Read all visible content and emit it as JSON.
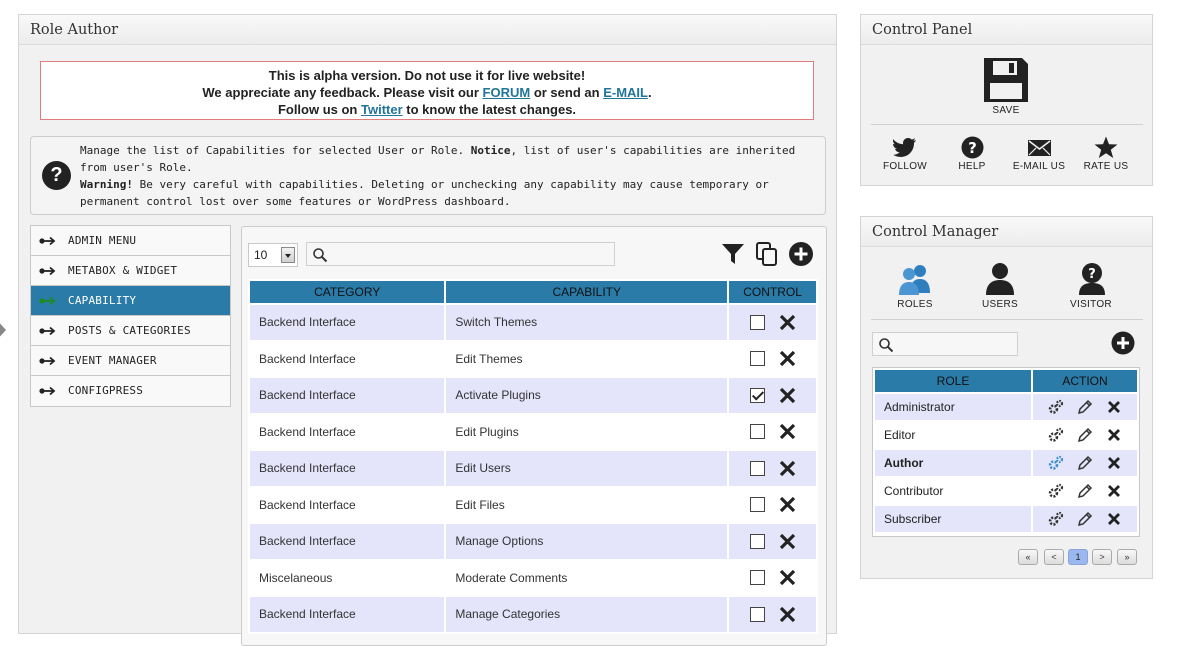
{
  "main": {
    "title": "Role Author",
    "notice": {
      "line1": "This is alpha version. Do not use it for live website!",
      "line2_pre": "We appreciate any feedback. Please visit our",
      "forum_link": "FORUM",
      "line2_mid": "or send an",
      "email_link": "E-MAIL",
      "line2_end": ".",
      "line3_pre": "Follow us on",
      "twitter_link": "Twitter",
      "line3_post": "to know the latest changes."
    },
    "help": {
      "icon_text": "?",
      "t1": "Manage the list of Capabilities for selected User or Role.",
      "t1_bold": "Notice",
      "t2": ", list of user's capabilities are inherited from user's Role.",
      "t3_bold": "Warning!",
      "t4": "Be very careful with capabilities. Deleting or unchecking any capability may cause temporary or permanent control lost over some features or WordPress dashboard."
    }
  },
  "menu": {
    "items": [
      {
        "label": "ADMIN MENU",
        "active": false
      },
      {
        "label": "METABOX & WIDGET",
        "active": false
      },
      {
        "label": "CAPABILITY",
        "active": true
      },
      {
        "label": "POSTS & CATEGORIES",
        "active": false
      },
      {
        "label": "EVENT MANAGER",
        "active": false
      },
      {
        "label": "CONFIGPRESS",
        "active": false
      }
    ]
  },
  "capability_table": {
    "page_size": "10",
    "search_value": "",
    "columns": [
      "CATEGORY",
      "CAPABILITY",
      "CONTROL"
    ],
    "rows": [
      {
        "category": "Backend Interface",
        "capability": "Switch Themes",
        "checked": false
      },
      {
        "category": "Backend Interface",
        "capability": "Edit Themes",
        "checked": false
      },
      {
        "category": "Backend Interface",
        "capability": "Activate Plugins",
        "checked": true
      },
      {
        "category": "Backend Interface",
        "capability": "Edit Plugins",
        "checked": false
      },
      {
        "category": "Backend Interface",
        "capability": "Edit Users",
        "checked": false
      },
      {
        "category": "Backend Interface",
        "capability": "Edit Files",
        "checked": false
      },
      {
        "category": "Backend Interface",
        "capability": "Manage Options",
        "checked": false
      },
      {
        "category": "Miscelaneous",
        "capability": "Moderate Comments",
        "checked": false
      },
      {
        "category": "Backend Interface",
        "capability": "Manage Categories",
        "checked": false
      }
    ]
  },
  "control_panel": {
    "title": "Control Panel",
    "save_label": "SAVE",
    "follow_label": "FOLLOW",
    "help_label": "HELP",
    "email_label": "E-MAIL US",
    "rate_label": "RATE US"
  },
  "control_manager": {
    "title": "Control Manager",
    "roles_label": "ROLES",
    "users_label": "USERS",
    "visitor_label": "VISITOR",
    "search_value": "",
    "columns": [
      "ROLE",
      "ACTION"
    ],
    "roles": [
      {
        "name": "Administrator",
        "current": false
      },
      {
        "name": "Editor",
        "current": false
      },
      {
        "name": "Author",
        "current": true
      },
      {
        "name": "Contributor",
        "current": false
      },
      {
        "name": "Subscriber",
        "current": false
      }
    ],
    "pager": {
      "first": "«",
      "prev": "<",
      "page": "1",
      "next": ">",
      "last": "»"
    }
  },
  "colors": {
    "accent": "#2a7ba8",
    "row_alt": "#e4e4fb",
    "notice_border": "#e17c7c",
    "link": "#21759b",
    "active_gear": "#3a8fd0"
  }
}
